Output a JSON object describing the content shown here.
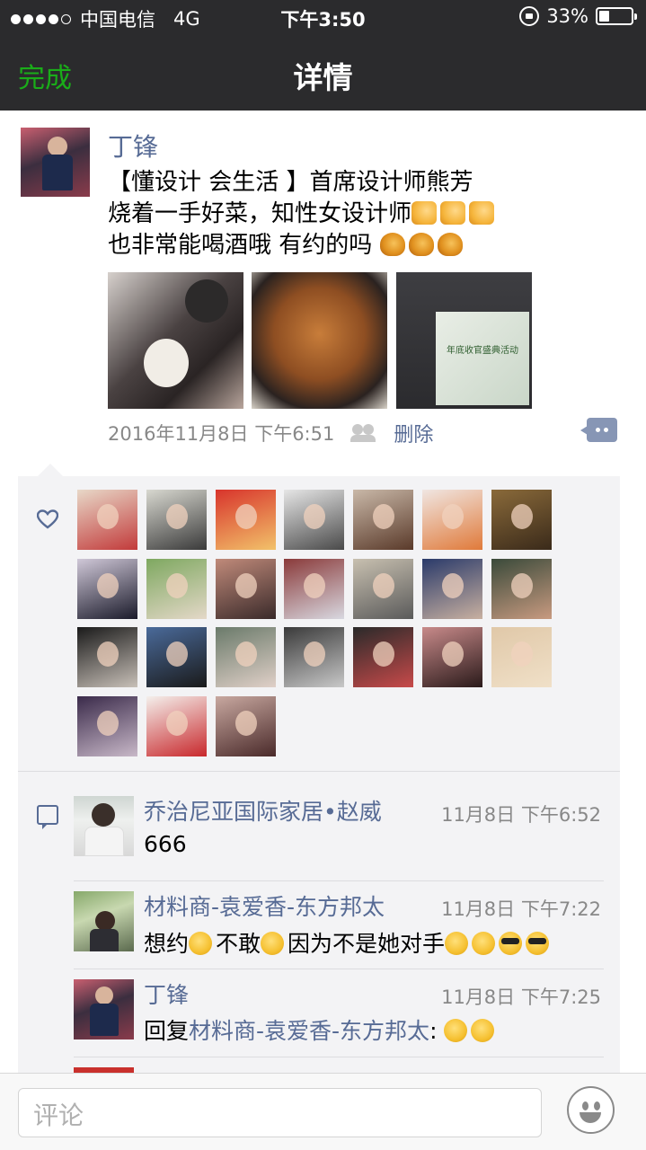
{
  "status_bar": {
    "carrier": "中国电信",
    "network": "4G",
    "time": "下午3:50",
    "battery": "33%",
    "battery_level": 0.33
  },
  "nav": {
    "done_label": "完成",
    "title": "详情"
  },
  "post": {
    "author": "丁锋",
    "text_lines": [
      "【懂设计 会生活 】首席设计师熊芳",
      "烧着一手好菜，知性女设计师",
      "也非常能喝酒哦 有约的吗"
    ],
    "datetime": "2016年11月8日 下午6:51",
    "delete_label": "删除",
    "photo3_caption": "年底收官盛典活动"
  },
  "likes": {
    "count": 24
  },
  "comments": [
    {
      "name": "乔治尼亚国际家居•赵威",
      "time": "11月8日 下午6:52",
      "text": "666"
    },
    {
      "name": "材料商-袁爱香-东方邦太",
      "time": "11月8日 下午7:22",
      "text_parts": [
        "想约",
        "不敢",
        "因为不是她对手"
      ]
    },
    {
      "name": "丁锋",
      "time": "11月8日 下午7:25",
      "reply_prefix": "回复",
      "reply_to": "材料商-袁爱香-东方邦太",
      "reply_suffix": ":"
    }
  ],
  "input": {
    "placeholder": "评论"
  },
  "colors": {
    "accent_green": "#1aad19",
    "link_blue": "#576b95",
    "nav_bg": "#2b2b2d"
  }
}
